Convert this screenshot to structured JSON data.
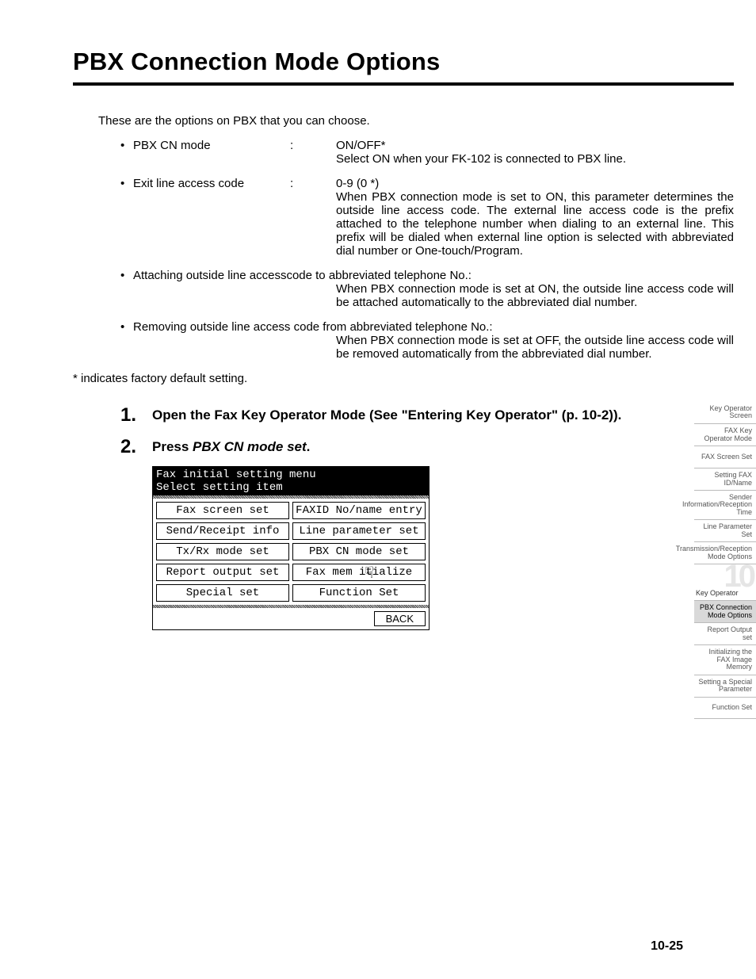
{
  "title": "PBX Connection Mode Options",
  "intro": "These are the options on PBX that you can choose.",
  "options": [
    {
      "label": "PBX CN mode",
      "value": "ON/OFF*",
      "desc": "Select ON when your FK-102 is connected to PBX line."
    },
    {
      "label": "Exit line access code",
      "value": "0-9 (0 *)",
      "desc": "When PBX connection mode is set to ON, this parameter determines the outside line access code. The external line access code is the prefix attached to the telephone number when dialing to an external line. This prefix will be dialed when external line option is selected with abbreviated dial number or One-touch/Program."
    }
  ],
  "full_options": [
    {
      "label": "Attaching outside line accesscode to abbreviated telephone No.:",
      "desc": "When PBX connection mode is set at ON, the outside line access code will be attached automatically to the abbreviated dial number."
    },
    {
      "label": "Removing outside line access code from abbreviated telephone No.:",
      "desc": "When PBX connection mode is set at OFF, the outside line access code will be removed automatically from the abbreviated dial number."
    }
  ],
  "footnote": "* indicates factory default setting.",
  "steps": {
    "s1a": "Open the Fax Key Operator Mode (See \"Entering Key Operator\" (p. 10-2)).",
    "s2a": "Press ",
    "s2b": "PBX CN mode set",
    "s2c": "."
  },
  "screen": {
    "header1": "Fax initial setting menu",
    "header2": "Select setting item",
    "buttons": [
      "Fax screen set",
      "FAXID No/name entry",
      "Send/Receipt info",
      "Line parameter set",
      "Tx/Rx mode set",
      "PBX CN mode set",
      "Report output set",
      "Fax mem    itialize",
      "Special set",
      "Function Set"
    ],
    "back": "BACK"
  },
  "sidetabs": [
    "Key Operator Screen",
    "FAX Key Operator Mode",
    "FAX Screen Set",
    "Setting FAX ID/Name",
    "Sender Information/Reception Time",
    "Line Parameter Set",
    "Transmission/Reception Mode Options"
  ],
  "chapter": {
    "num": "10",
    "label": "Key Operator"
  },
  "sidetabs2": [
    "PBX Connection Mode Options",
    "Report Output set",
    "Initializing the FAX Image Memory",
    "Setting a Special Parameter",
    "Function Set"
  ],
  "pagenum": "10-25"
}
